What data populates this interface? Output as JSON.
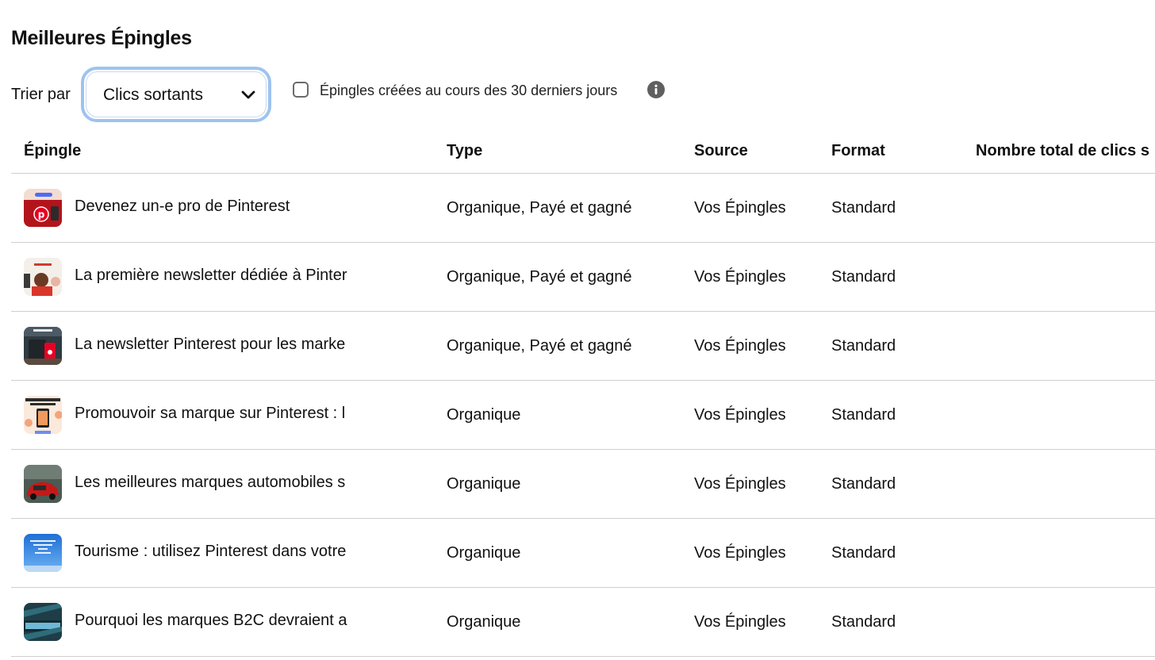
{
  "page": {
    "title": "Meilleures Épingles"
  },
  "sort": {
    "label": "Trier par",
    "selected": "Clics sortants"
  },
  "filter": {
    "label": "Épingles créées au cours des 30 derniers jours",
    "checked": false,
    "info_icon": "info-icon"
  },
  "table": {
    "columns": {
      "pin": "Épingle",
      "type": "Type",
      "source": "Source",
      "format": "Format",
      "total": "Nombre total de clics s"
    },
    "rows": [
      {
        "title": "Devenez un-e pro de Pinterest",
        "type": "Organique, Payé et gagné",
        "source": "Vos Épingles",
        "format": "Standard"
      },
      {
        "title": "La première newsletter dédiée à Pinter",
        "type": "Organique, Payé et gagné",
        "source": "Vos Épingles",
        "format": "Standard"
      },
      {
        "title": "La newsletter Pinterest pour les marke",
        "type": "Organique, Payé et gagné",
        "source": "Vos Épingles",
        "format": "Standard"
      },
      {
        "title": "Promouvoir sa marque sur Pinterest : l",
        "type": "Organique",
        "source": "Vos Épingles",
        "format": "Standard"
      },
      {
        "title": "Les meilleures marques automobiles s",
        "type": "Organique",
        "source": "Vos Épingles",
        "format": "Standard"
      },
      {
        "title": "Tourisme : utilisez Pinterest dans votre",
        "type": "Organique",
        "source": "Vos Épingles",
        "format": "Standard"
      },
      {
        "title": "Pourquoi les marques B2C devraient a",
        "type": "Organique",
        "source": "Vos Épingles",
        "format": "Standard"
      }
    ]
  },
  "colors": {
    "focus_ring": "#9ec3f0",
    "divider": "#cfcfcf",
    "text": "#111111",
    "pinterest_red": "#e60023"
  }
}
